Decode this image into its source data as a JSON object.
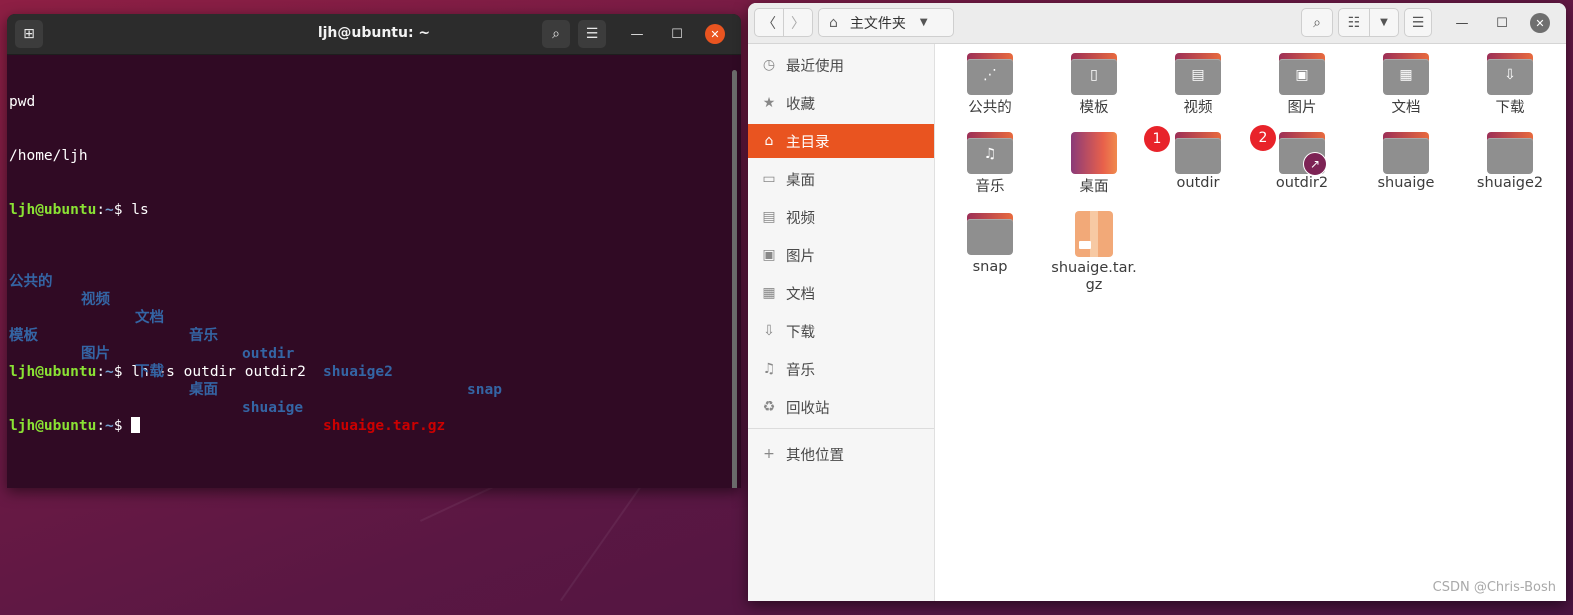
{
  "terminal": {
    "title": "ljh@ubuntu: ~",
    "lines": {
      "l1": "pwd",
      "l2": "/home/ljh",
      "prompt_user": "ljh@ubuntu",
      "prompt_sep": ":",
      "prompt_path": "~",
      "prompt_dollar": "$ ",
      "cmd_ls": "ls",
      "cmd_ln": "ln -s outdir outdir2"
    },
    "ls_row1": [
      "公共的",
      "视频",
      "文档",
      "音乐",
      "outdir",
      "shuaige2",
      "snap"
    ],
    "ls_row2": [
      "模板",
      "图片",
      "下载",
      "桌面",
      "shuaige",
      "shuaige.tar.gz"
    ],
    "colors": {
      "background": "#300a24",
      "prompt_user": "#8ae234",
      "directory": "#3465a4",
      "archive": "#cc0000"
    }
  },
  "files": {
    "location_label": "主文件夹",
    "sidebar": [
      {
        "label": "最近使用",
        "icon": "clock-icon"
      },
      {
        "label": "收藏",
        "icon": "star-icon"
      },
      {
        "label": "主目录",
        "icon": "home-icon",
        "active": true
      },
      {
        "label": "桌面",
        "icon": "desktop-icon"
      },
      {
        "label": "视频",
        "icon": "video-icon"
      },
      {
        "label": "图片",
        "icon": "image-icon"
      },
      {
        "label": "文档",
        "icon": "document-icon"
      },
      {
        "label": "下载",
        "icon": "download-icon"
      },
      {
        "label": "音乐",
        "icon": "music-icon"
      },
      {
        "label": "回收站",
        "icon": "trash-icon"
      },
      {
        "label": "其他位置",
        "icon": "plus-icon"
      }
    ],
    "items": [
      {
        "label": "公共的",
        "kind": "folder",
        "symbol": "share"
      },
      {
        "label": "模板",
        "kind": "folder",
        "symbol": "template"
      },
      {
        "label": "视频",
        "kind": "folder",
        "symbol": "video"
      },
      {
        "label": "图片",
        "kind": "folder",
        "symbol": "image"
      },
      {
        "label": "文档",
        "kind": "folder",
        "symbol": "document"
      },
      {
        "label": "下载",
        "kind": "folder",
        "symbol": "download"
      },
      {
        "label": "音乐",
        "kind": "folder",
        "symbol": "music"
      },
      {
        "label": "桌面",
        "kind": "desktop"
      },
      {
        "label": "outdir",
        "kind": "folder"
      },
      {
        "label": "outdir2",
        "kind": "folder-link"
      },
      {
        "label": "shuaige",
        "kind": "folder"
      },
      {
        "label": "shuaige2",
        "kind": "folder"
      },
      {
        "label": "snap",
        "kind": "folder"
      },
      {
        "label": "shuaige.tar.\ngz",
        "kind": "archive"
      }
    ],
    "markers": [
      "1",
      "2"
    ],
    "accent": "#e95420"
  },
  "watermark": "CSDN @Chris-Bosh"
}
